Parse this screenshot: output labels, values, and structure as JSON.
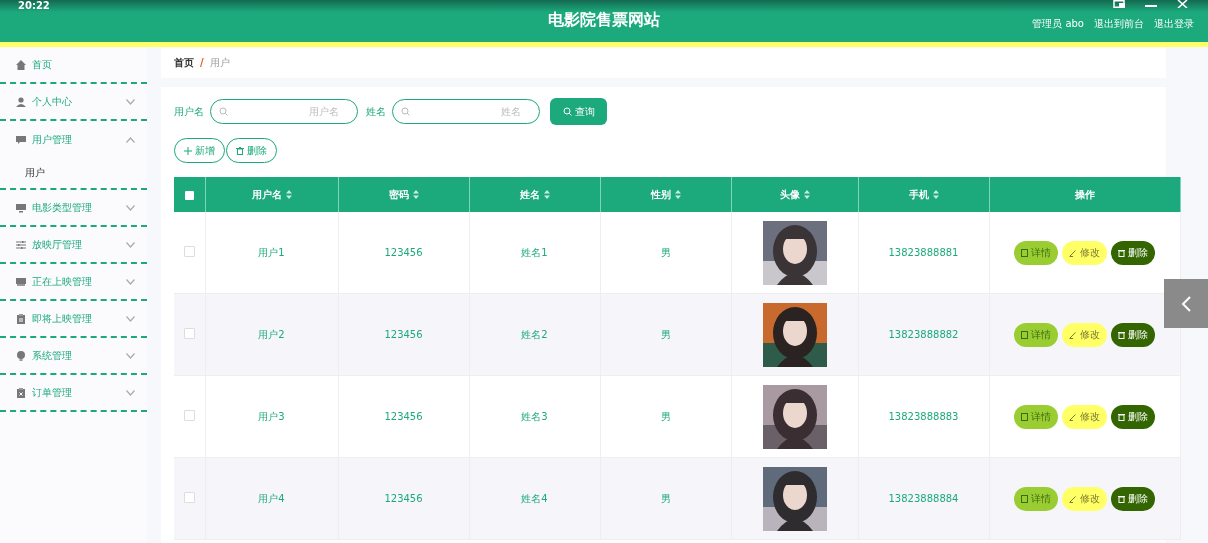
{
  "status_time": "20:22",
  "header": {
    "title": "电影院售票网站",
    "user": "管理员 abo",
    "links": [
      "退出到前台",
      "退出登录"
    ]
  },
  "sidebar": {
    "items": [
      {
        "label": "首页"
      },
      {
        "label": "个人中心",
        "expanded": false
      },
      {
        "label": "用户管理",
        "expanded": true,
        "children": [
          {
            "label": "用户"
          }
        ]
      },
      {
        "label": "电影类型管理",
        "expanded": false
      },
      {
        "label": "放映厅管理",
        "expanded": false
      },
      {
        "label": "正在上映管理",
        "expanded": false
      },
      {
        "label": "即将上映管理",
        "expanded": false
      },
      {
        "label": "系统管理",
        "expanded": false
      },
      {
        "label": "订单管理",
        "expanded": false
      }
    ]
  },
  "breadcrumb": {
    "items": [
      "首页",
      "用户"
    ],
    "separator": "/"
  },
  "search": {
    "fields": [
      {
        "label": "用户名",
        "placeholder": "用户名"
      },
      {
        "label": "姓名",
        "placeholder": "姓名"
      }
    ],
    "button": "查询"
  },
  "actions": [
    {
      "kind": "add",
      "label": "新增"
    },
    {
      "kind": "delete",
      "label": "删除"
    }
  ],
  "table": {
    "columns": [
      {
        "label": "用户名",
        "sortable": true
      },
      {
        "label": "密码",
        "sortable": true
      },
      {
        "label": "姓名",
        "sortable": true
      },
      {
        "label": "性别",
        "sortable": true
      },
      {
        "label": "头像",
        "sortable": true
      },
      {
        "label": "手机",
        "sortable": true
      },
      {
        "label": "操作",
        "sortable": false
      }
    ],
    "select_all_checked": false,
    "rows": [
      {
        "checked": false,
        "username": "用户1",
        "password": "123456",
        "name": "姓名1",
        "gender": "男",
        "avatar": {
          "kind": "picture"
        },
        "phone": "13823888881",
        "buttons": [
          {
            "kind": "detail",
            "label": "详情"
          },
          {
            "kind": "edit",
            "label": "修改"
          },
          {
            "kind": "delete",
            "label": "删除"
          }
        ]
      },
      {
        "checked": false,
        "username": "用户2",
        "password": "123456",
        "name": "姓名2",
        "gender": "男",
        "avatar": {
          "kind": "picture"
        },
        "phone": "13823888882",
        "buttons": [
          {
            "kind": "detail",
            "label": "详情"
          },
          {
            "kind": "edit",
            "label": "修改"
          },
          {
            "kind": "delete",
            "label": "删除"
          }
        ]
      },
      {
        "checked": false,
        "username": "用户3",
        "password": "123456",
        "name": "姓名3",
        "gender": "男",
        "avatar": {
          "kind": "picture"
        },
        "phone": "13823888883",
        "buttons": [
          {
            "kind": "detail",
            "label": "详情"
          },
          {
            "kind": "edit",
            "label": "修改"
          },
          {
            "kind": "delete",
            "label": "删除"
          }
        ]
      },
      {
        "checked": false,
        "username": "用户4",
        "password": "123456",
        "name": "姓名4",
        "gender": "男",
        "avatar": {
          "kind": "picture"
        },
        "phone": "13823888884",
        "buttons": [
          {
            "kind": "detail",
            "label": "详情"
          },
          {
            "kind": "edit",
            "label": "修改"
          },
          {
            "kind": "delete",
            "label": "删除"
          }
        ]
      }
    ]
  }
}
